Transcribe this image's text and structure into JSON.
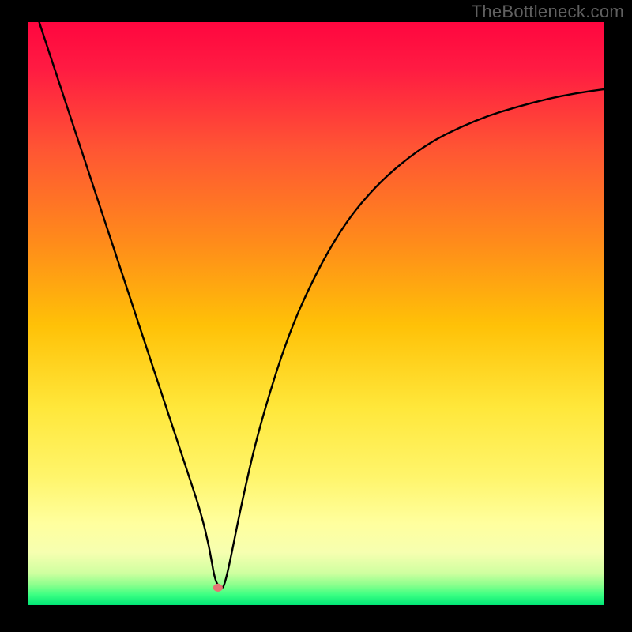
{
  "watermark": "TheBottleneck.com",
  "chart_data": {
    "type": "line",
    "title": "",
    "xlabel": "",
    "ylabel": "",
    "xlim": [
      0,
      100
    ],
    "ylim": [
      0,
      100
    ],
    "grid": false,
    "legend": false,
    "background_gradient": {
      "top": "#ff1744",
      "mid_upper": "#ff9800",
      "mid": "#ffeb3b",
      "mid_lower": "#ffff8d",
      "bottom": "#00e676"
    },
    "series": [
      {
        "name": "curve",
        "x": [
          2,
          5,
          10,
          15,
          20,
          25,
          28,
          30,
          31.5,
          32.5,
          33.5,
          34,
          35,
          37,
          40,
          45,
          50,
          55,
          60,
          65,
          70,
          75,
          80,
          85,
          90,
          95,
          100
        ],
        "y": [
          100,
          91,
          76,
          61,
          46,
          31,
          22,
          16,
          10,
          4,
          3,
          3,
          7,
          17,
          30,
          46,
          57,
          65.5,
          71.5,
          76,
          79.5,
          82,
          84,
          85.5,
          86.8,
          87.8,
          88.5
        ]
      }
    ],
    "marker": {
      "x": 33,
      "y": 3,
      "color": "#e57373",
      "radius_px": 6
    }
  }
}
